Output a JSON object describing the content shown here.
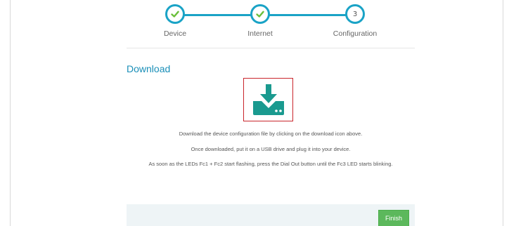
{
  "wizard": {
    "steps": [
      {
        "label": "Device",
        "state": "complete"
      },
      {
        "label": "Internet",
        "state": "complete"
      },
      {
        "label": "Configuration",
        "state": "current",
        "number": "3"
      }
    ]
  },
  "section": {
    "title": "Download"
  },
  "download_icon": {
    "icon": "download-to-device-icon",
    "color": "#1a9a8f",
    "highlight_color": "#c9252c"
  },
  "instructions": {
    "line1": "Download the device configuration file by clicking on the download icon above.",
    "line2": "Once downloaded, put it on a USB drive and plug it into your device.",
    "line3": "As soon as the LEDs Fc1 + Fc2 start flashing, press the Dial Out button until the Fc3 LED starts blinking."
  },
  "footer": {
    "finish_label": "Finish"
  },
  "colors": {
    "accent": "#1aa3c6",
    "check": "#6abf3a",
    "finish_button": "#5cb85c",
    "title": "#1a8fb8"
  }
}
